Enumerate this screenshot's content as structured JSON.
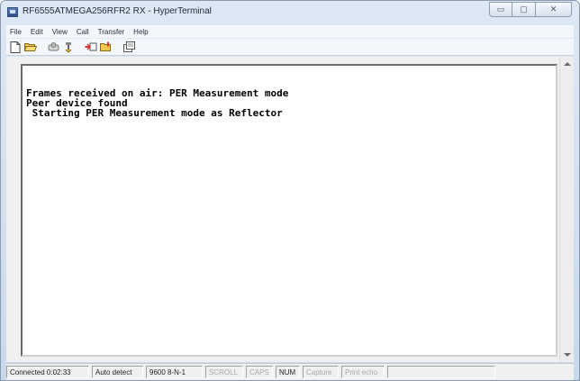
{
  "window": {
    "title": "RF6555ATMEGA256RFR2 RX - HyperTerminal",
    "icons": {
      "app": "hyperterminal-app-icon",
      "minimize": "minimize-icon",
      "maximize": "maximize-icon",
      "close": "close-icon"
    },
    "buttons": {
      "minimize": "▭",
      "maximize": "▢",
      "close": "✕"
    }
  },
  "menubar": {
    "items": [
      "File",
      "Edit",
      "View",
      "Call",
      "Transfer",
      "Help"
    ]
  },
  "toolbar": {
    "icons": [
      "new-connection-icon",
      "open-icon",
      "connect-icon",
      "disconnect-icon",
      "send-icon",
      "receive-icon",
      "properties-icon"
    ]
  },
  "terminal": {
    "lines": [
      "",
      "Frames received on air: PER Measurement mode",
      "Peer device found",
      " Starting PER Measurement mode as Reflector"
    ]
  },
  "statusbar": {
    "connected": "Connected 0:02:33",
    "detect": "Auto detect",
    "port": "9600 8-N-1",
    "scroll": "SCROLL",
    "caps": "CAPS",
    "num": "NUM",
    "capture": "Capture",
    "print_echo": "Print echo"
  },
  "colors": {
    "titlebar": "#c9d9ec",
    "terminal_bg": "#ffffff",
    "terminal_text": "#000000",
    "status_dim": "#a8a8a8"
  }
}
